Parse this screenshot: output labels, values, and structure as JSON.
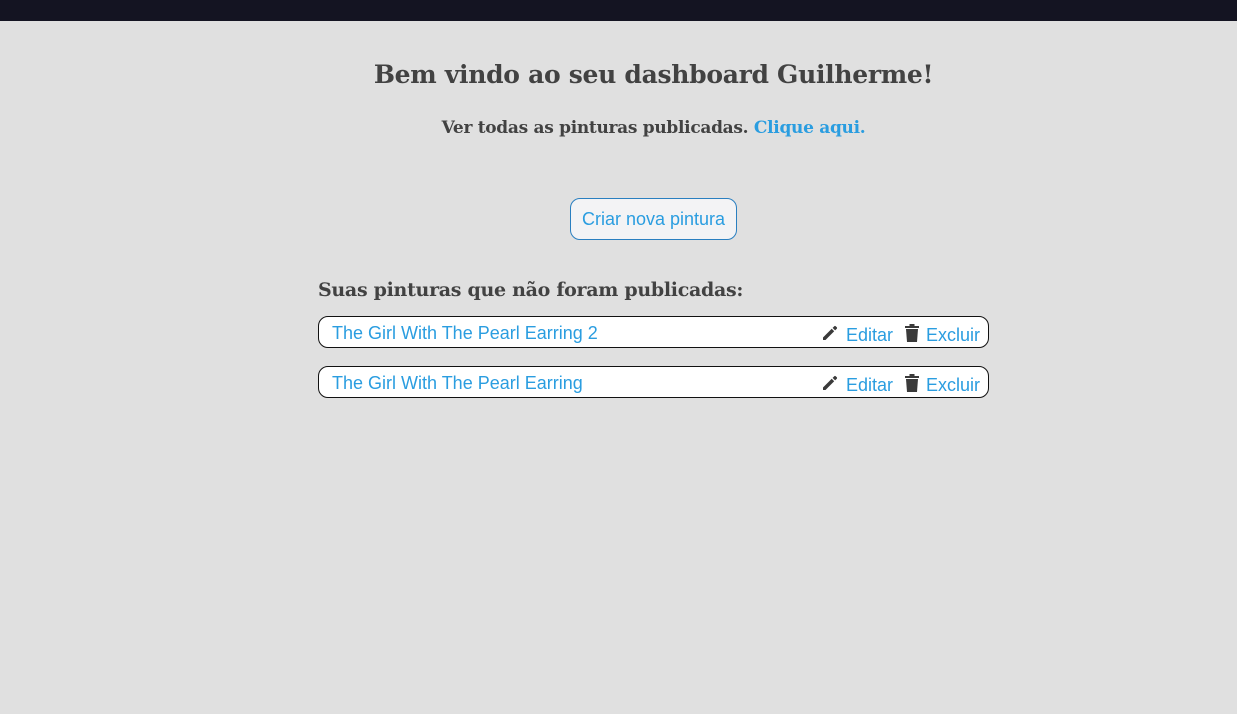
{
  "colors": {
    "background": "#e0e0e0",
    "topbar": "#141422",
    "text": "#424242",
    "link": "#2a9de0",
    "icon": "#3a3a3a"
  },
  "header": {
    "title": "Bem vindo ao seu dashboard Guilherme!",
    "subtitle_text": "Ver todas as pinturas publicadas.",
    "subtitle_link": "Clique aqui."
  },
  "actions": {
    "create_label": "Criar nova pintura"
  },
  "unpublished": {
    "heading": "Suas pinturas que não foram publicadas:",
    "items": [
      {
        "name": "The Girl With The Pearl Earring 2",
        "edit_label": "Editar",
        "edit_icon": "pencil-icon",
        "delete_label": "Excluir",
        "delete_icon": "trash-icon"
      },
      {
        "name": "The Girl With The Pearl Earring",
        "edit_label": "Editar",
        "edit_icon": "pencil-icon",
        "delete_label": "Excluir",
        "delete_icon": "trash-icon"
      }
    ]
  }
}
